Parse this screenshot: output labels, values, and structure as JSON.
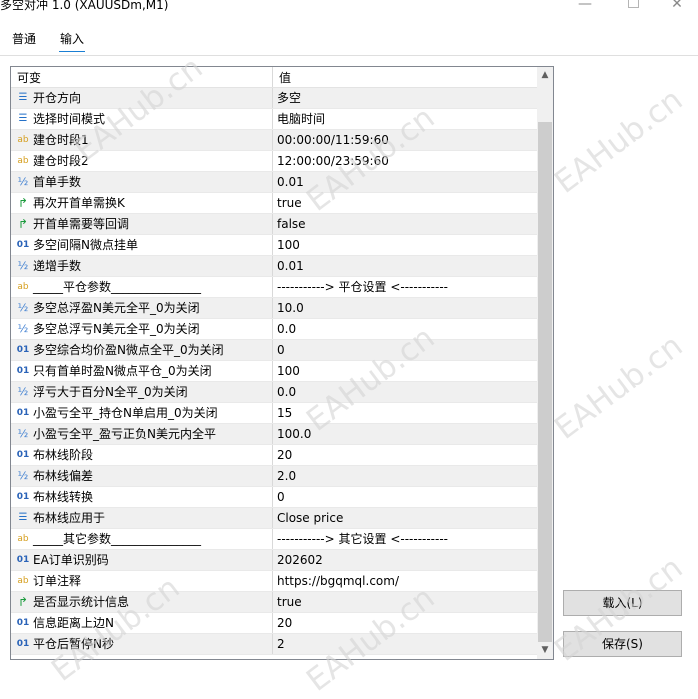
{
  "window": {
    "title": "多空对冲 1.0 (XAUUSDm,M1)",
    "min_glyph": "—",
    "close_glyph": "✕"
  },
  "tabs": [
    {
      "label": "普通"
    },
    {
      "label": "输入"
    }
  ],
  "grid": {
    "header": {
      "name": "可变",
      "value": "值"
    },
    "rows": [
      {
        "icon": "enum",
        "glyph": "☰",
        "name": "开仓方向",
        "value": "多空"
      },
      {
        "icon": "enum",
        "glyph": "☰",
        "name": "选择时间模式",
        "value": "电脑时间"
      },
      {
        "icon": "string",
        "glyph": "ab",
        "name": "建仓时段1",
        "value": "00:00:00/11:59:60"
      },
      {
        "icon": "string",
        "glyph": "ab",
        "name": "建仓时段2",
        "value": "12:00:00/23:59:60"
      },
      {
        "icon": "double",
        "glyph": "½",
        "name": "首单手数",
        "value": "0.01"
      },
      {
        "icon": "bool",
        "glyph": "↱",
        "name": "再次开首单需换K",
        "value": "true"
      },
      {
        "icon": "bool",
        "glyph": "↱",
        "name": "开首单需要等回调",
        "value": "false"
      },
      {
        "icon": "int",
        "glyph": "01",
        "name": "多空间隔N微点挂单",
        "value": "100"
      },
      {
        "icon": "double",
        "glyph": "½",
        "name": "递增手数",
        "value": "0.01"
      },
      {
        "icon": "string",
        "glyph": "ab",
        "name": "_____平仓参数_______________",
        "value": "-----------> 平仓设置 <-----------"
      },
      {
        "icon": "double",
        "glyph": "½",
        "name": "多空总浮盈N美元全平_0为关闭",
        "value": "10.0"
      },
      {
        "icon": "double",
        "glyph": "½",
        "name": "多空总浮亏N美元全平_0为关闭",
        "value": "0.0"
      },
      {
        "icon": "int",
        "glyph": "01",
        "name": "多空综合均价盈N微点全平_0为关闭",
        "value": "0"
      },
      {
        "icon": "int",
        "glyph": "01",
        "name": "只有首单时盈N微点平仓_0为关闭",
        "value": "100"
      },
      {
        "icon": "double",
        "glyph": "½",
        "name": "浮亏大于百分N全平_0为关闭",
        "value": "0.0"
      },
      {
        "icon": "int",
        "glyph": "01",
        "name": "小盈亏全平_持仓N单启用_0为关闭",
        "value": "15"
      },
      {
        "icon": "double",
        "glyph": "½",
        "name": "小盈亏全平_盈亏正负N美元内全平",
        "value": "100.0"
      },
      {
        "icon": "int",
        "glyph": "01",
        "name": "布林线阶段",
        "value": "20"
      },
      {
        "icon": "double",
        "glyph": "½",
        "name": "布林线偏差",
        "value": "2.0"
      },
      {
        "icon": "int",
        "glyph": "01",
        "name": "布林线转换",
        "value": "0"
      },
      {
        "icon": "enum",
        "glyph": "☰",
        "name": "布林线应用于",
        "value": "Close price"
      },
      {
        "icon": "string",
        "glyph": "ab",
        "name": "_____其它参数_______________",
        "value": "-----------> 其它设置 <-----------"
      },
      {
        "icon": "int",
        "glyph": "01",
        "name": "EA订单识别码",
        "value": "202602"
      },
      {
        "icon": "string",
        "glyph": "ab",
        "name": "订单注释",
        "value": "https://bgqmql.com/"
      },
      {
        "icon": "bool",
        "glyph": "↱",
        "name": "是否显示统计信息",
        "value": "true"
      },
      {
        "icon": "int",
        "glyph": "01",
        "name": "信息距离上边N",
        "value": "20"
      },
      {
        "icon": "int",
        "glyph": "01",
        "name": "平仓后暂停N秒",
        "value": "2"
      }
    ]
  },
  "scrollbar": {
    "up_glyph": "▲",
    "down_glyph": "▼"
  },
  "buttons": {
    "load": "载入(L)",
    "save": "保存(S)"
  },
  "watermark": "EAHub.cn"
}
